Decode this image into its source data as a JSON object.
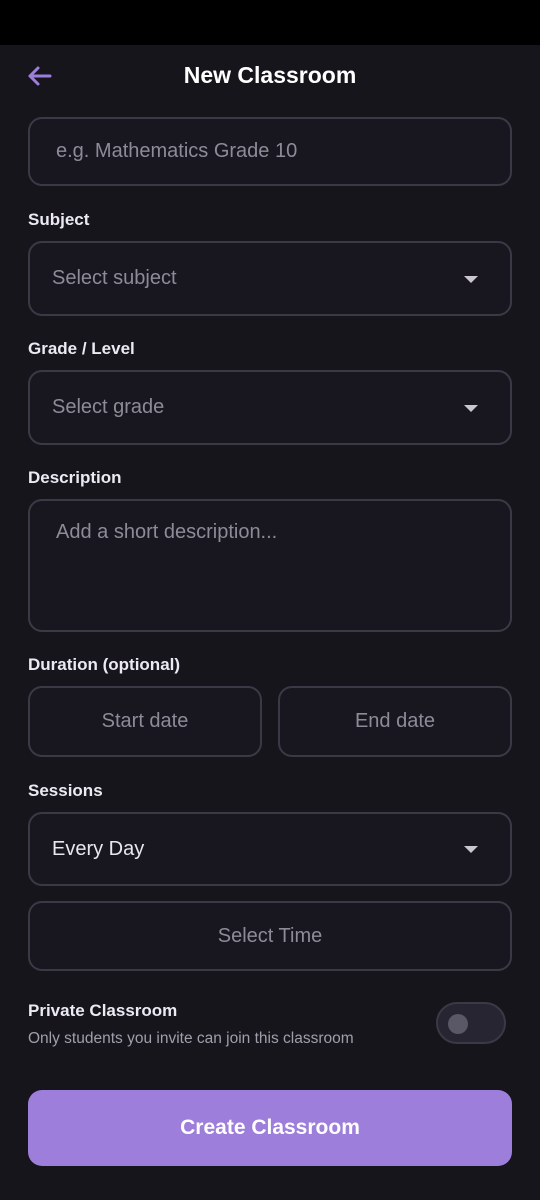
{
  "header": {
    "title": "New Classroom",
    "back_icon": "arrow-left-icon",
    "accent": "#9d7edb"
  },
  "form": {
    "name": {
      "placeholder": "e.g. Mathematics Grade 10",
      "value": ""
    },
    "subject": {
      "label": "Subject",
      "placeholder": "Select subject"
    },
    "grade": {
      "label": "Grade / Level",
      "placeholder": "Select grade"
    },
    "description": {
      "label": "Description",
      "placeholder": "Add a short description..."
    },
    "duration": {
      "label": "Duration (optional)",
      "start_placeholder": "Start date",
      "end_placeholder": "End date"
    },
    "sessions": {
      "label": "Sessions",
      "value": "Every Day",
      "time_placeholder": "Select Time"
    },
    "private": {
      "title": "Private Classroom",
      "subtitle": "Only students you invite can join this classroom",
      "enabled": false
    }
  },
  "actions": {
    "create_label": "Create Classroom"
  },
  "icons": {
    "dropdown": "caret-down-icon"
  }
}
